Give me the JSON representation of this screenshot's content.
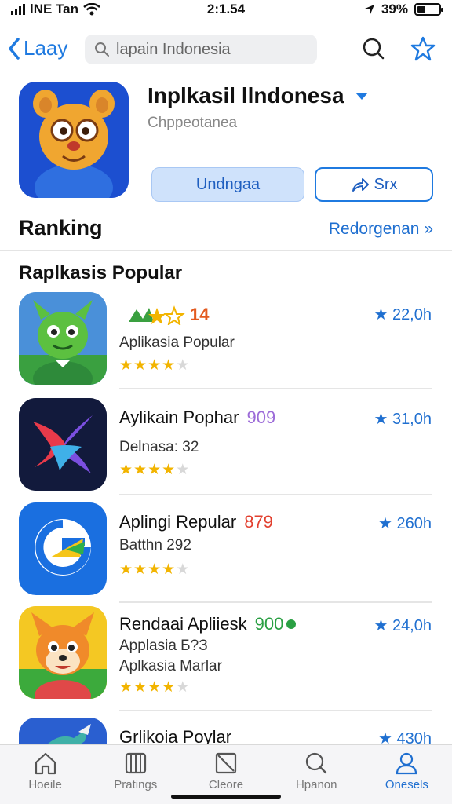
{
  "status_bar": {
    "carrier": "lNE Tan",
    "time": "2:1.54",
    "battery": "39%",
    "battery_level": 0.39
  },
  "nav": {
    "back_label": "Laay",
    "search_placeholder": "lapain Indonesia"
  },
  "app": {
    "title": "Inplkasil llndonesa",
    "subtitle": "Chppeotanea",
    "primary_button": "Undngaa",
    "share_button": "Srx"
  },
  "ranking": {
    "title": "Ranking",
    "link": "Redorgenan »"
  },
  "section": {
    "title": "Raplkasis Popular"
  },
  "list": [
    {
      "name": "",
      "badge": "14",
      "line2": "Aplikasia Popular",
      "line3": "",
      "rating": 4,
      "meta": "★ 22,0h",
      "icon": "green-creature-icon"
    },
    {
      "name": "Aylikain Pophar",
      "badge": "909",
      "line2": "Delnasa: 32",
      "line3": "",
      "rating": 4,
      "meta": "★ 31,0h",
      "icon": "bird-logo-icon"
    },
    {
      "name": "Aplingi Repular",
      "badge": "879",
      "line2": "Batthn 292",
      "line3": "",
      "rating": 4,
      "meta": "★ 260h",
      "icon": "g-logo-icon"
    },
    {
      "name": "Rendaai Apliiesk",
      "badge": "900",
      "line2": "Applasia Б?З",
      "line3": "Aplkasia Marlar",
      "rating": 4,
      "meta": "★ 24,0h",
      "icon": "fox-character-icon"
    },
    {
      "name": "Grlikoia Poylar",
      "badge": "",
      "line2": "",
      "line3": "",
      "rating": 0,
      "meta": "★ 430h",
      "icon": "bird-icon"
    }
  ],
  "tabs": [
    {
      "label": "Hoeile",
      "icon": "home-icon"
    },
    {
      "label": "Pratings",
      "icon": "book-icon"
    },
    {
      "label": "Cleore",
      "icon": "square-icon"
    },
    {
      "label": "Hpanon",
      "icon": "search-icon"
    },
    {
      "label": "Onesels",
      "icon": "person-icon"
    }
  ],
  "colors": {
    "accent": "#1f7ae0",
    "star": "#f2b400"
  }
}
